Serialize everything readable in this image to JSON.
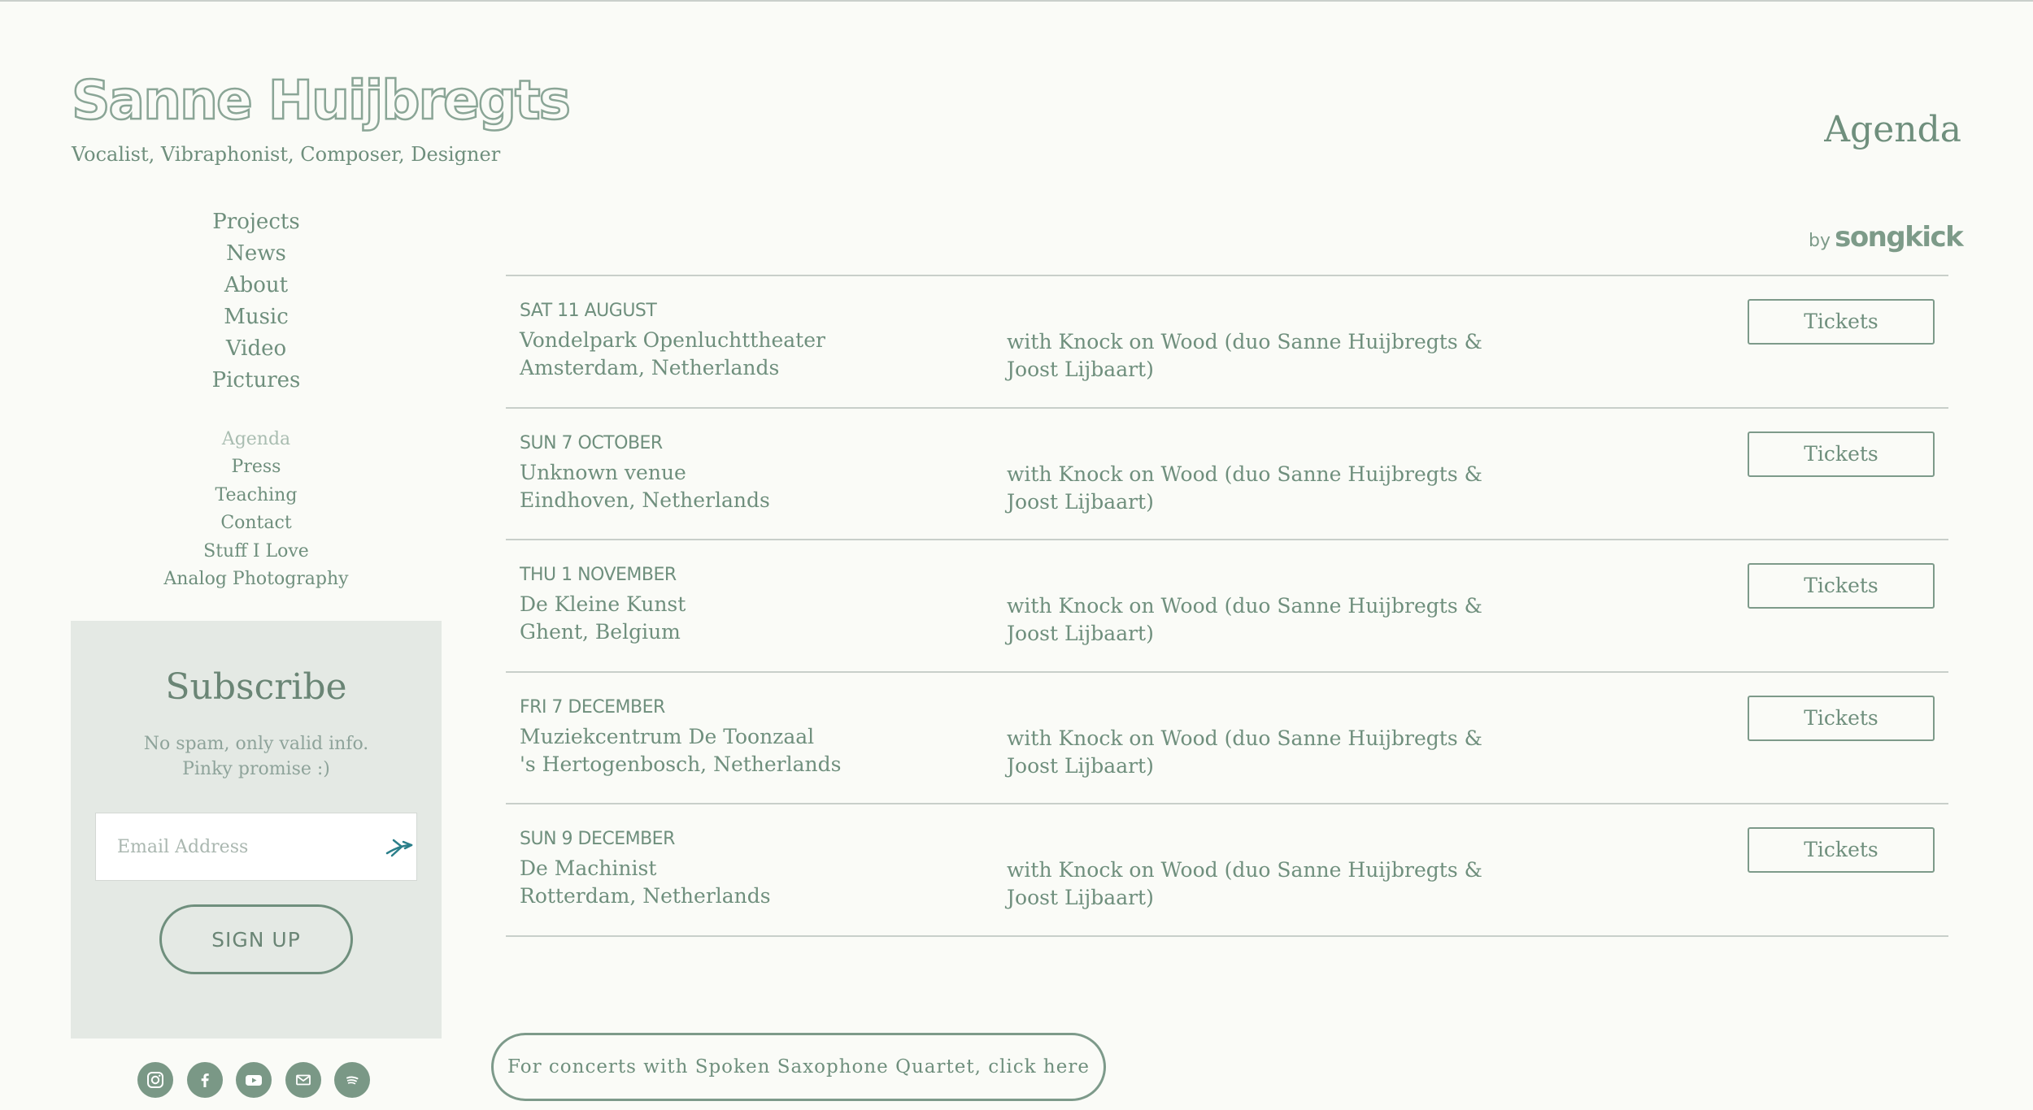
{
  "site": {
    "title": "Sanne Huijbregts",
    "subtitle": "Vocalist, Vibraphonist, Composer, Designer"
  },
  "nav": {
    "primary": [
      "Projects",
      "News",
      "About",
      "Music",
      "Video",
      "Pictures"
    ],
    "secondary": [
      "Agenda",
      "Press",
      "Teaching",
      "Contact",
      "Stuff I Love",
      "Analog Photography"
    ],
    "active": "Agenda"
  },
  "subscribe": {
    "title": "Subscribe",
    "line1": "No spam, only valid info.",
    "line2": "Pinky promise :)",
    "email_placeholder": "Email Address",
    "email_value": "",
    "button": "SIGN UP"
  },
  "social": [
    "instagram-icon",
    "facebook-icon",
    "youtube-icon",
    "email-icon",
    "spotify-icon"
  ],
  "page": {
    "title": "Agenda",
    "songkick_by": "by",
    "songkick_brand": "songkick"
  },
  "events": [
    {
      "date": "SAT 11 AUGUST",
      "venue": "Vondelpark Openluchttheater",
      "city": "Amsterdam, Netherlands",
      "with": "with Knock on Wood (duo Sanne Huijbregts & Joost Lijbaart)",
      "tickets": "Tickets"
    },
    {
      "date": "SUN 7 OCTOBER",
      "venue": "Unknown venue",
      "city": "Eindhoven, Netherlands",
      "with": "with Knock on Wood (duo Sanne Huijbregts & Joost Lijbaart)",
      "tickets": "Tickets"
    },
    {
      "date": "THU 1 NOVEMBER",
      "venue": "De Kleine Kunst",
      "city": "Ghent, Belgium",
      "with": "with Knock on Wood (duo Sanne Huijbregts & Joost Lijbaart)",
      "tickets": "Tickets"
    },
    {
      "date": "FRI 7 DECEMBER",
      "venue": "Muziekcentrum De Toonzaal",
      "city": "'s Hertogenbosch, Netherlands",
      "with": "with Knock on Wood (duo Sanne Huijbregts & Joost Lijbaart)",
      "tickets": "Tickets"
    },
    {
      "date": "SUN 9 DECEMBER",
      "venue": "De Machinist",
      "city": "Rotterdam, Netherlands",
      "with": "with Knock on Wood (duo Sanne Huijbregts & Joost Lijbaart)",
      "tickets": "Tickets"
    }
  ],
  "quartet_link": "For concerts with Spoken Saxophone Quartet, click here",
  "colors": {
    "background": "#fafbf7",
    "text": "#6f8f7d",
    "panel": "#e4e9e4",
    "divider": "#c8cfca",
    "accent": "#2a7f8a"
  }
}
